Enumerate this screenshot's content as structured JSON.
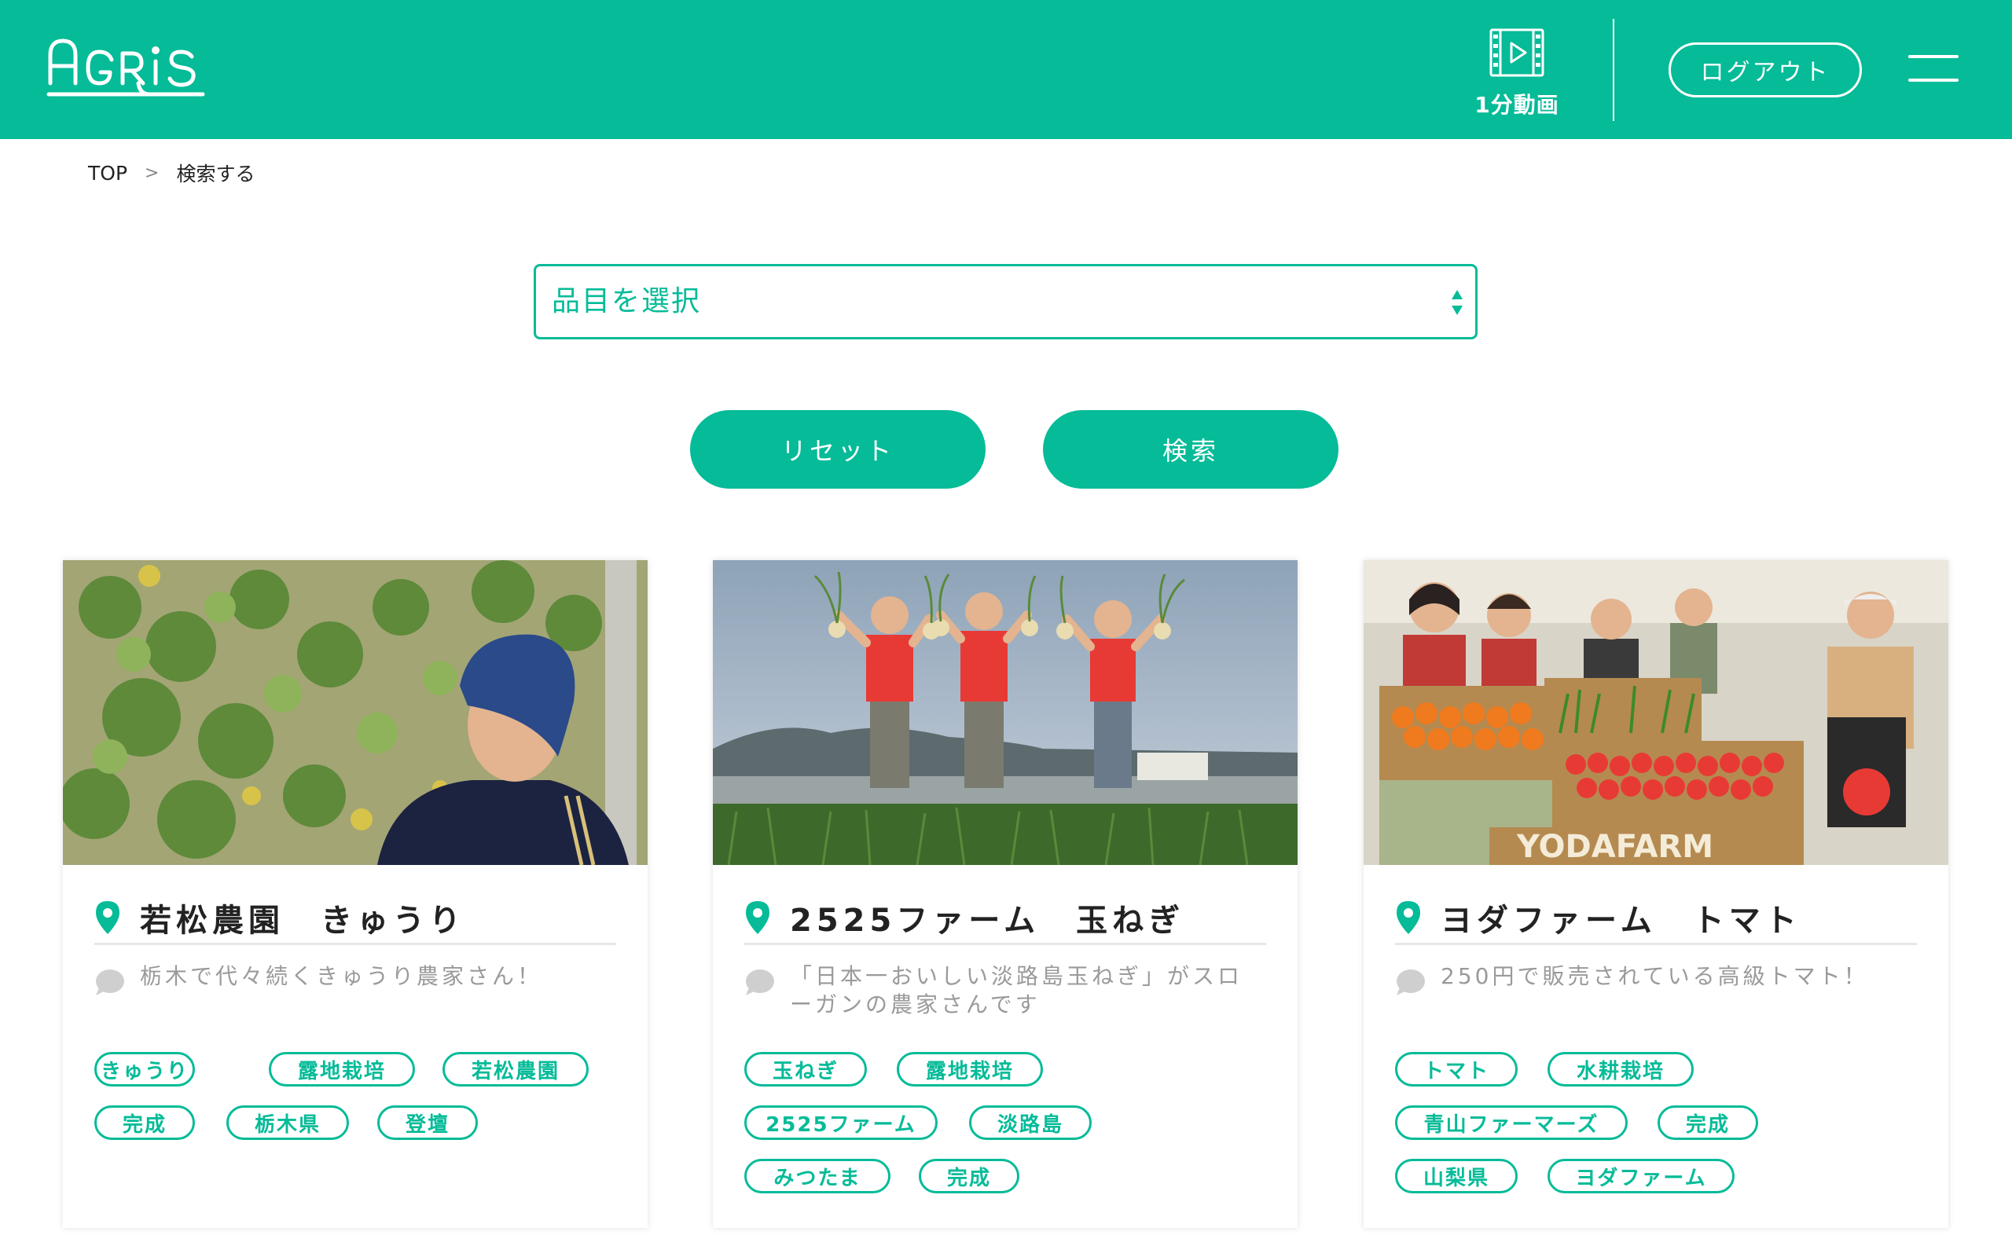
{
  "header": {
    "logo_text": "AGRiS",
    "video_label": "1分動画",
    "logout_label": "ログアウト"
  },
  "breadcrumb": {
    "home": "TOP",
    "separator": ">",
    "current": "検索する"
  },
  "search": {
    "select_label": "品目を選択",
    "reset_label": "リセット",
    "search_label": "検索"
  },
  "colors": {
    "brand": "#05bb98",
    "muted_text": "#9a9a9a"
  },
  "cards": [
    {
      "title": "若松農園　きゅうり",
      "description": "栃木で代々続くきゅうり農家さん！",
      "tags": [
        "きゅうり",
        "露地栽培",
        "若松農園",
        "完成",
        "栃木県",
        "登壇"
      ]
    },
    {
      "title": "2525ファーム　玉ねぎ",
      "description": "「日本一おいしい淡路島玉ねぎ」がスローガンの農家さんです",
      "tags": [
        "玉ねぎ",
        "露地栽培",
        "2525ファーム",
        "淡路島",
        "みつたま",
        "完成"
      ]
    },
    {
      "title": "ヨダファーム　トマト",
      "description": "250円で販売されている高級トマト！",
      "photo_sign": "YODAFARM",
      "tags": [
        "トマト",
        "水耕栽培",
        "青山ファーマーズ",
        "完成",
        "山梨県",
        "ヨダファーム"
      ]
    }
  ]
}
